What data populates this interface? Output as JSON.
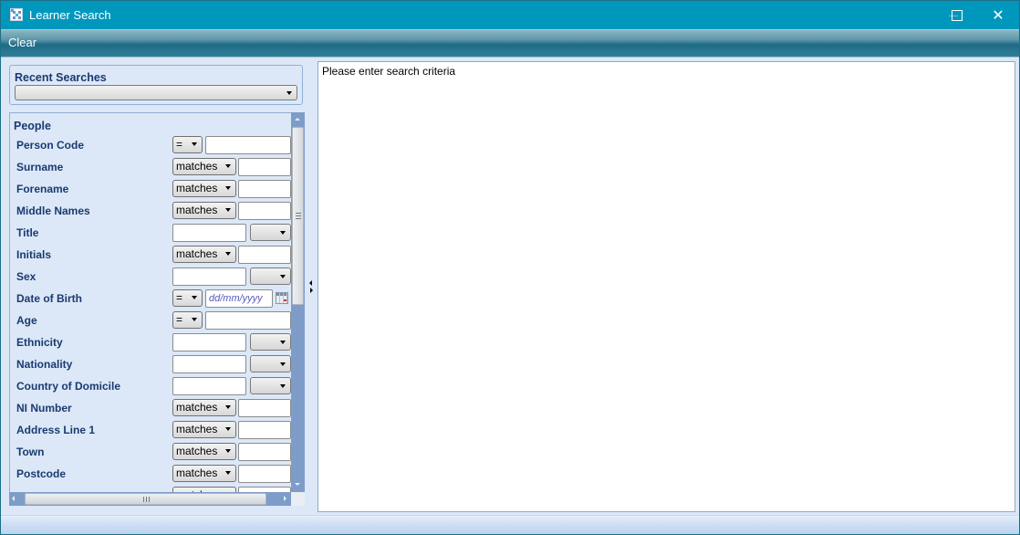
{
  "window": {
    "title": "Learner Search",
    "controls": {
      "minimize": "minimize",
      "maximize": "maximize",
      "close": "✕"
    }
  },
  "toolbar": {
    "clear_label": "Clear"
  },
  "recent_searches": {
    "label": "Recent Searches",
    "selected": ""
  },
  "people": {
    "label": "People",
    "fields": [
      {
        "label": "Person Code",
        "kind": "op-small-text",
        "operator": "=",
        "value": ""
      },
      {
        "label": "Surname",
        "kind": "op-wide-text",
        "operator": "matches",
        "value": ""
      },
      {
        "label": "Forename",
        "kind": "op-wide-text",
        "operator": "matches",
        "value": ""
      },
      {
        "label": "Middle Names",
        "kind": "op-wide-text",
        "operator": "matches",
        "value": ""
      },
      {
        "label": "Title",
        "kind": "text-dropdown",
        "value": "",
        "selected": ""
      },
      {
        "label": "Initials",
        "kind": "op-wide-text",
        "operator": "matches",
        "value": ""
      },
      {
        "label": "Sex",
        "kind": "text-dropdown",
        "value": "",
        "selected": ""
      },
      {
        "label": "Date of Birth",
        "kind": "op-small-date",
        "operator": "=",
        "placeholder": "dd/mm/yyyy"
      },
      {
        "label": "Age",
        "kind": "op-small-text",
        "operator": "=",
        "value": ""
      },
      {
        "label": "Ethnicity",
        "kind": "text-dropdown",
        "value": "",
        "selected": ""
      },
      {
        "label": "Nationality",
        "kind": "text-dropdown",
        "value": "",
        "selected": ""
      },
      {
        "label": "Country of Domicile",
        "kind": "text-dropdown",
        "value": "",
        "selected": ""
      },
      {
        "label": "NI Number",
        "kind": "op-wide-text",
        "operator": "matches",
        "value": ""
      },
      {
        "label": "Address Line 1",
        "kind": "op-wide-text",
        "operator": "matches",
        "value": ""
      },
      {
        "label": "Town",
        "kind": "op-wide-text",
        "operator": "matches",
        "value": ""
      },
      {
        "label": "Postcode",
        "kind": "op-wide-text",
        "operator": "matches",
        "value": ""
      },
      {
        "label": "",
        "kind": "op-wide-text",
        "operator": "matches",
        "value": ""
      }
    ]
  },
  "results": {
    "message": "Please enter search criteria"
  }
}
